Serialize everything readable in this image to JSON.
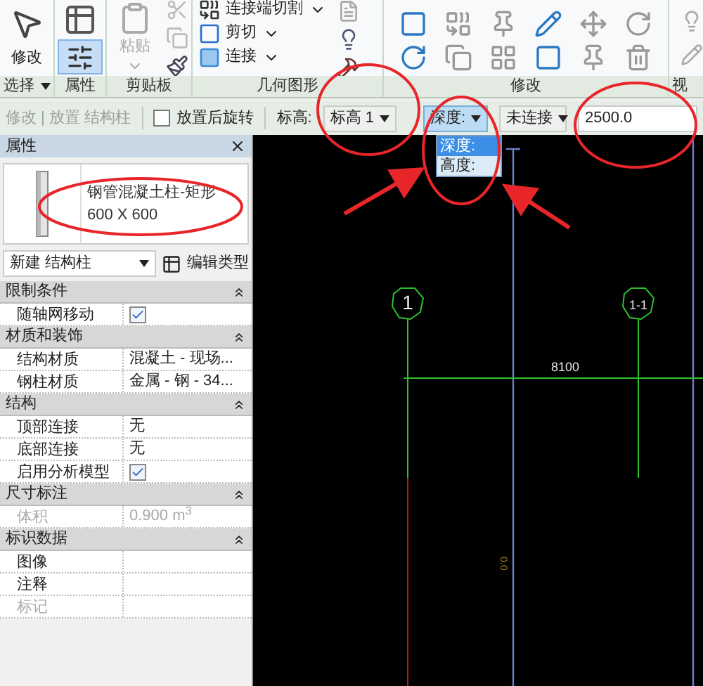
{
  "ribbon": {
    "panels": [
      {
        "label": "选择",
        "tools": [
          {
            "kind": "big",
            "label": "修改"
          }
        ]
      },
      {
        "label": "属性",
        "tools": [
          {
            "kind": "icon",
            "selected": false
          },
          {
            "kind": "icon",
            "selected": true
          }
        ]
      },
      {
        "label": "剪贴板",
        "tools": [
          {
            "kind": "paste",
            "label": "粘贴",
            "disabled": true
          }
        ]
      },
      {
        "label": "几何图形",
        "tools": [
          {
            "kind": "row",
            "label": "连接端切割"
          },
          {
            "kind": "row",
            "label": "剪切"
          },
          {
            "kind": "row",
            "label": "连接"
          }
        ]
      },
      {
        "label": "修改"
      },
      {
        "label": "视"
      }
    ]
  },
  "options_bar": {
    "context": "修改 | 放置 结构柱",
    "rotate": {
      "label": "放置后旋转",
      "checked": false
    },
    "level_label": "标高:",
    "level_value": "标高 1",
    "mode_value": "深度:",
    "connection": "未连接",
    "height_value": "2500.0",
    "mode_list": [
      {
        "label": "深度:",
        "selected": true
      },
      {
        "label": "高度:",
        "selected": false
      }
    ]
  },
  "properties": {
    "title": "属性",
    "type_name": "钢管混凝土柱-矩形",
    "type_size": "600 X 600",
    "instance": "新建 结构柱",
    "edit_type": "编辑类型",
    "groups": [
      {
        "title": "限制条件",
        "rows": [
          {
            "label": "随轴网移动",
            "kind": "checkbox",
            "checked": true,
            "disabled": false
          }
        ]
      },
      {
        "title": "材质和装饰",
        "rows": [
          {
            "label": "结构材质",
            "kind": "text",
            "value": "混凝土 - 现场...",
            "disabled": false
          },
          {
            "label": "钢柱材质",
            "kind": "text",
            "value": "金属 - 钢 - 34...",
            "disabled": false
          }
        ]
      },
      {
        "title": "结构",
        "rows": [
          {
            "label": "顶部连接",
            "kind": "text",
            "value": "无",
            "disabled": false
          },
          {
            "label": "底部连接",
            "kind": "text",
            "value": "无",
            "disabled": false
          },
          {
            "label": "启用分析模型",
            "kind": "checkbox",
            "checked": true,
            "disabled": false
          }
        ]
      },
      {
        "title": "尺寸标注",
        "rows": [
          {
            "label": "体积",
            "kind": "text",
            "value": "0.900 m$^{3}$",
            "disabled": true
          }
        ]
      },
      {
        "title": "标识数据",
        "rows": [
          {
            "label": "图像",
            "kind": "text",
            "disabled": false
          },
          {
            "label": "注释",
            "kind": "text",
            "disabled": false
          },
          {
            "label": "标记",
            "kind": "text",
            "disabled": true
          }
        ]
      }
    ]
  },
  "canvas": {
    "grids": [
      {
        "label": "1"
      },
      {
        "label": "1-1"
      }
    ],
    "dimension": "8100",
    "elevation": "0.0"
  }
}
